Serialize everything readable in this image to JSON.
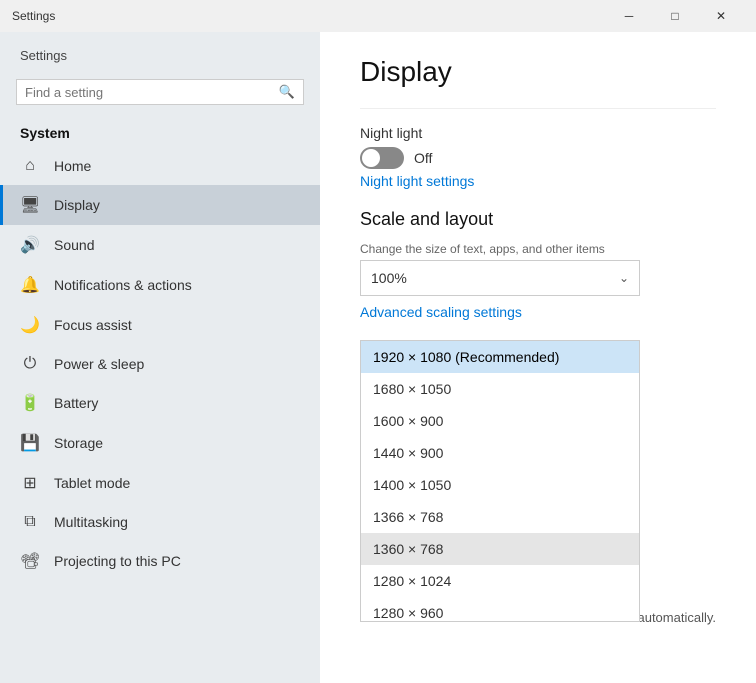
{
  "titlebar": {
    "title": "Settings",
    "minimize": "─",
    "maximize": "□",
    "close": "✕"
  },
  "sidebar": {
    "search_placeholder": "Find a setting",
    "section_label": "System",
    "items": [
      {
        "id": "home",
        "icon": "⌂",
        "label": "Home"
      },
      {
        "id": "display",
        "icon": "🖥",
        "label": "Display",
        "active": true
      },
      {
        "id": "sound",
        "icon": "🔊",
        "label": "Sound"
      },
      {
        "id": "notifications",
        "icon": "🔔",
        "label": "Notifications & actions"
      },
      {
        "id": "focus",
        "icon": "🌙",
        "label": "Focus assist"
      },
      {
        "id": "power",
        "icon": "⏻",
        "label": "Power & sleep"
      },
      {
        "id": "battery",
        "icon": "🔋",
        "label": "Battery"
      },
      {
        "id": "storage",
        "icon": "💾",
        "label": "Storage"
      },
      {
        "id": "tablet",
        "icon": "⊞",
        "label": "Tablet mode"
      },
      {
        "id": "multitasking",
        "icon": "⧉",
        "label": "Multitasking"
      },
      {
        "id": "projecting",
        "icon": "📽",
        "label": "Projecting to this PC"
      }
    ]
  },
  "content": {
    "page_title": "Display",
    "night_light_label": "Night light",
    "toggle_state": "Off",
    "night_light_link": "Night light settings",
    "scale_heading": "Scale and layout",
    "scale_description": "Change the size of text, apps, and other items",
    "scale_selected": "100%",
    "advanced_link": "Advanced scaling settings",
    "resolution_options": [
      {
        "value": "1920 × 1080 (Recommended)",
        "selected": true
      },
      {
        "value": "1680 × 1050"
      },
      {
        "value": "1600 × 900"
      },
      {
        "value": "1440 × 900"
      },
      {
        "value": "1400 × 1050"
      },
      {
        "value": "1366 × 768"
      },
      {
        "value": "1360 × 768",
        "highlighted": true
      },
      {
        "value": "1280 × 1024"
      },
      {
        "value": "1280 × 960"
      }
    ],
    "auto_text": "automatically."
  }
}
